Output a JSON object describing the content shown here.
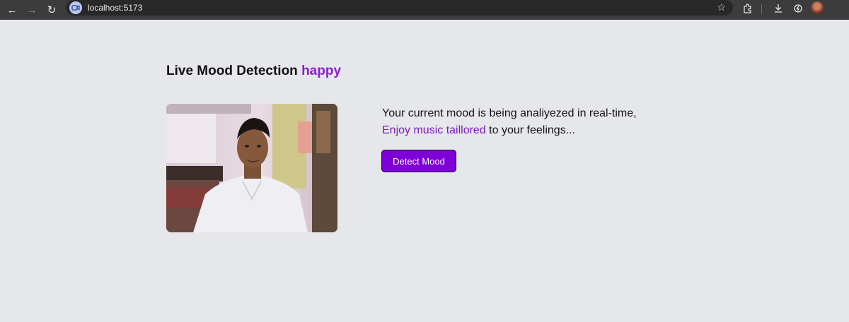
{
  "browser": {
    "url": "localhost:5173",
    "icons": {
      "back": "back-arrow-icon",
      "forward": "forward-arrow-icon",
      "reload": "reload-icon",
      "bookmark": "star-icon",
      "extensions": "extensions-icon",
      "downloads": "download-icon",
      "profile": "avatar"
    }
  },
  "page": {
    "title_prefix": "Live Mood Detection",
    "detected_mood": "happy",
    "description_line1": "Your current mood is being analiyezed in real-time,",
    "description_accent": "Enjoy music taillored",
    "description_rest": " to your feelings...",
    "detect_button_label": "Detect Mood"
  },
  "colors": {
    "background": "#e6e7eb",
    "accent": "#8a1ed4",
    "button": "#7f00d6"
  }
}
